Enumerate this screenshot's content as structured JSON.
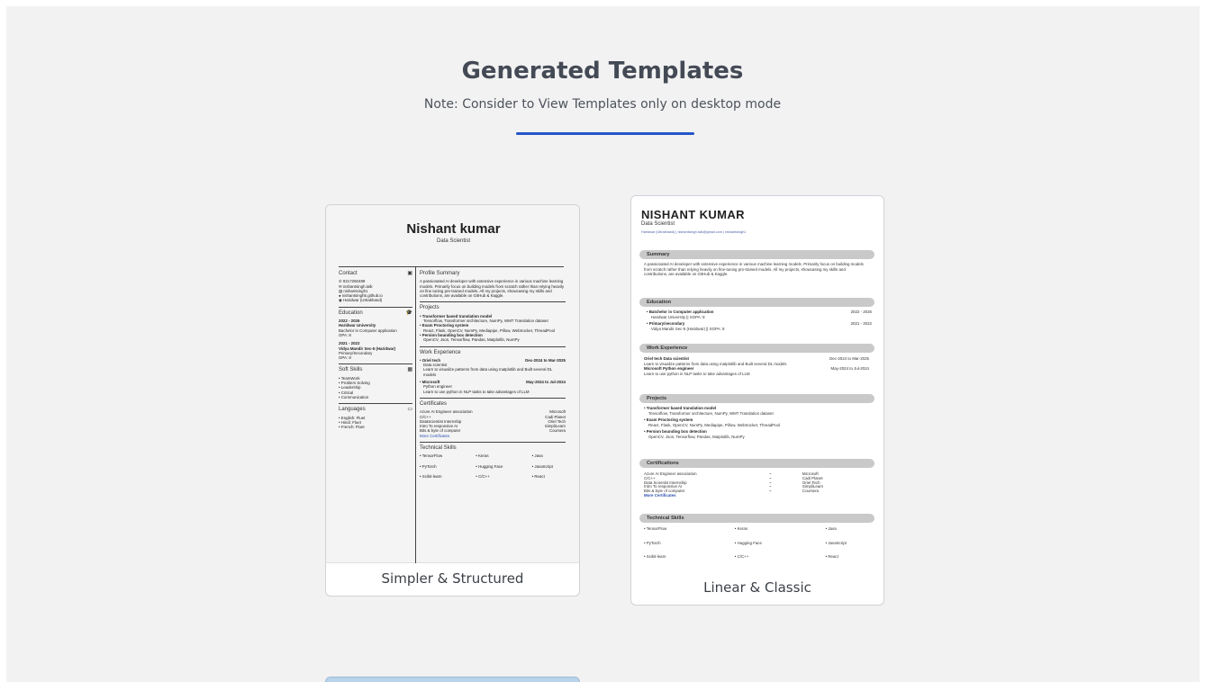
{
  "header": {
    "title": "Generated Templates",
    "note": "Note: Consider to View Templates only on desktop mode"
  },
  "colors": {
    "accent": "#2457c7",
    "background": "#f2f2f3",
    "card_border": "#cfd2d7"
  },
  "templates": [
    {
      "label": "Simpler & Structured",
      "preview": {
        "name": "Nishant kumar",
        "role": "Data Scientist",
        "contact_head": "Contact",
        "contact": [
          "9217250489",
          "nishantsingh.talk",
          "nishantsingh1",
          "nishantsingh5.github.io",
          "Haridwar (Uttrakhand)"
        ],
        "education_head": "Education",
        "education": [
          {
            "years": "2022 - 2026",
            "school": "Haridwar University",
            "degree": "Bachelor in Computer application",
            "gpa": "GPA: 8"
          },
          {
            "years": "2021 - 2022",
            "school": "Vidya Mandir Sec-5 (Haridwar)",
            "degree": "Primary/Secondary",
            "gpa": "GPA: 8"
          }
        ],
        "soft_head": "Soft Skills",
        "soft": [
          "TeamWork",
          "Problem Solving",
          "Leadership",
          "Critical",
          "Communication"
        ],
        "lang_head": "Languages",
        "langs": [
          "English: Fluet",
          "Hindi: Fluet",
          "French: Fluet"
        ],
        "profile_head": "Profile Summary",
        "profile": "A passionated AI developer with extensive experience in various machine learning models. Primarily focus on building models from scratch rather than relying heavily on fine tuning pre-trained models. All my projects, showcasing my skills and contributions, are available on GitHub & Kaggle.",
        "projects_head": "Projects",
        "projects": [
          {
            "title": "Transformer based translation model",
            "desc": "Tensorflow, Transformer architecture, NumPy, WMT Translation dataset"
          },
          {
            "title": "Exam Proctoring system",
            "desc": "React, Flask, OpenCV, NumPy, Mediapipe, Pillow, WebSocket, ThreadPool"
          },
          {
            "title": "Persion bounding box detection",
            "desc": "OpenCV, Json, Tensorflow, Pandas, Matplotlib, NumPy"
          }
        ],
        "work_head": "Work Experience",
        "work": [
          {
            "company": "Oriel tech",
            "dates": "Dec-2024 to Mar-2025",
            "role": "Data scientist",
            "desc": "Learn to visualize patterns from data using matplotlib and Built several DL models"
          },
          {
            "company": "Microsoft",
            "dates": "May-2024 to Jul-2024",
            "role": "Python engineer",
            "desc": "Learn to use python in NLP tasks to take advantages of LLM"
          }
        ],
        "cert_head": "Certificates",
        "certs": [
          {
            "name": "Azure AI Engineer association",
            "org": "Microsoft"
          },
          {
            "name": "C/C++",
            "org": "Cadi Planet"
          },
          {
            "name": "DataScientist Internship",
            "org": "Oriel Tech"
          },
          {
            "name": "Intro To responsive AI",
            "org": "SimpliLearn"
          },
          {
            "name": "Bits & byte of computer",
            "org": "Coursera"
          }
        ],
        "more_certs": "More Certificates",
        "tech_head": "Technical Skills",
        "tech": [
          "TensorFlow",
          "Keras",
          "Java",
          "PyTorch",
          "Hugging Face",
          "JavaScript",
          "Scikit-learn",
          "C/C++",
          "React"
        ]
      }
    },
    {
      "label": "Linear & Classic",
      "preview": {
        "name": "NISHANT KUMAR",
        "role": "Data Scientist",
        "contact": "Haridwar (Uttrakhand) | nishantsingh.talk@gmail.com | nishantsingh1",
        "summary_head": "Summary",
        "summary": "A passionated AI developer with extensive experience in various machine learning models. Primarily focus on building models from scratch rather than relying heavily on fine-tuning pre-trained models. All my projects, showcasing my skills and contributions, are available on GitHub & Kaggle.",
        "education_head": "Education",
        "education": [
          {
            "degree": "Batchelor in Computer application",
            "years": "2022 - 2026",
            "school": "Haridwar University || SGPA: 8"
          },
          {
            "degree": "Primary/secondary",
            "years": "2021 - 2022",
            "school": "Vidya Mandir Sec-5 (Haridwar) || SGPA: 8"
          }
        ],
        "work_head": "Work Experience",
        "work": [
          {
            "title": "Oriel tech Data scientist",
            "dates": "Dec-2024 to Mar-2025",
            "desc": "Learn to visualize patterns from data using matplotlib and Built several DL models"
          },
          {
            "title": "Microsoft Python engineer",
            "dates": "May-2024 to Jul-2024",
            "desc": "Learn to use python in NLP tasks to take advantages of LLM"
          }
        ],
        "projects_head": "Projects",
        "projects": [
          {
            "title": "Transformer based translation model",
            "desc": "Tensorflow, Transformer architecture, NumPy, WMT Translation dataset"
          },
          {
            "title": "Exam Proctoring system",
            "desc": "React, Flask, OpenCV, NumPy, Mediapipe, Pillow, WebSocket, ThreadPool"
          },
          {
            "title": "Persion bounding box detection",
            "desc": "OpenCV, Json, Tensorflow, Pandas, Matplotlib, NumPy"
          }
        ],
        "cert_head": "Certifications",
        "certs": [
          {
            "name": "Azure AI Engineer association",
            "org": "Microsoft"
          },
          {
            "name": "C/C++",
            "org": "Cadi Planet"
          },
          {
            "name": "Data Scientist Internship",
            "org": "Oriel Tech"
          },
          {
            "name": "Intro To responsive AI",
            "org": "SimpliLearn"
          },
          {
            "name": "Bits & byte of computer",
            "org": "Coursera"
          }
        ],
        "more_certs": "More Certificates",
        "tech_head": "Technical Skills",
        "tech": [
          "TensorFlow",
          "Keras",
          "Java",
          "PyTorch",
          "Hugging Face",
          "JavaScript",
          "Scikit-learn",
          "C/C++",
          "React"
        ]
      }
    }
  ]
}
